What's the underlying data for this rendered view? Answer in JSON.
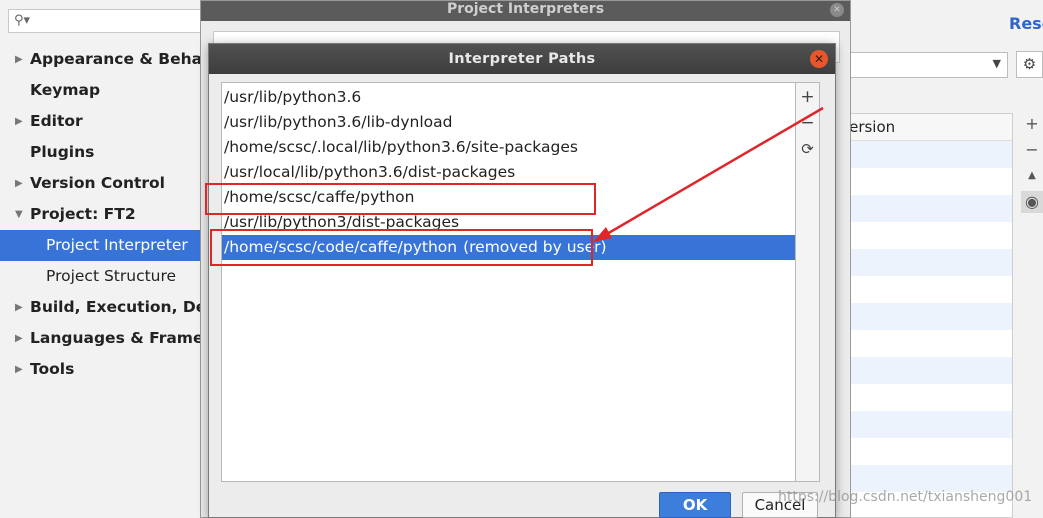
{
  "sidebar": {
    "search_placeholder": "",
    "items": [
      {
        "label": "Appearance & Behavior",
        "arrow": "▶",
        "level": 0
      },
      {
        "label": "Keymap",
        "arrow": "",
        "level": 0
      },
      {
        "label": "Editor",
        "arrow": "▶",
        "level": 0
      },
      {
        "label": "Plugins",
        "arrow": "",
        "level": 0
      },
      {
        "label": "Version Control",
        "arrow": "▶",
        "level": 0
      },
      {
        "label": "Project: FT2",
        "arrow": "▼",
        "level": 0
      },
      {
        "label": "Project Interpreter",
        "arrow": "",
        "level": 1,
        "selected": true
      },
      {
        "label": "Project Structure",
        "arrow": "",
        "level": 1
      },
      {
        "label": "Build, Execution, Deployment",
        "arrow": "▶",
        "level": 0
      },
      {
        "label": "Languages & Frameworks",
        "arrow": "▶",
        "level": 0
      },
      {
        "label": "Tools",
        "arrow": "▶",
        "level": 0
      }
    ]
  },
  "settings_panel": {
    "reset_label": "Reset",
    "table_header": "Version"
  },
  "back_dialog": {
    "title": "Project Interpreters",
    "close_glyph": "✕"
  },
  "dialog": {
    "title": "Interpreter Paths",
    "close_glyph": "✕",
    "paths": [
      {
        "path": "/usr/lib/python3.6",
        "note": ""
      },
      {
        "path": "/usr/lib/python3.6/lib-dynload",
        "note": ""
      },
      {
        "path": "/home/scsc/.local/lib/python3.6/site-packages",
        "note": ""
      },
      {
        "path": "/usr/local/lib/python3.6/dist-packages",
        "note": ""
      },
      {
        "path": "/home/scsc/caffe/python",
        "note": ""
      },
      {
        "path": "/usr/lib/python3/dist-packages",
        "note": ""
      },
      {
        "path": "/home/scsc/code/caffe/python",
        "note": "(removed by user)",
        "selected": true
      }
    ],
    "toolbar": {
      "add": "+",
      "remove": "−",
      "reload": "⟳"
    },
    "ok_label": "OK",
    "cancel_label": "Cancel"
  },
  "watermark": "https://blog.csdn.net/txiansheng001",
  "colors": {
    "selection": "#3874d8",
    "annotation": "#e0252b",
    "link": "#2f65ca"
  }
}
